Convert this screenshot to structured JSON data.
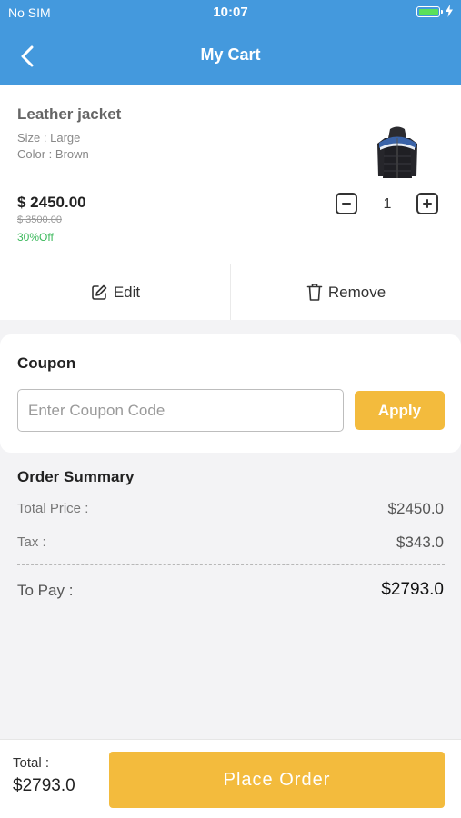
{
  "status_bar": {
    "carrier": "No SIM",
    "time": "10:07",
    "battery_level": 1.0,
    "charging": true,
    "battery_color": "#5be05b"
  },
  "header": {
    "title": "My Cart",
    "back_icon": "chevron-left-icon",
    "background_color": "#4499dd"
  },
  "cart_item": {
    "name": "Leather jacket",
    "size": "Size : Large",
    "color": "Color : Brown",
    "image_icon": "jacket-image",
    "price": "$ 2450.00",
    "old_price": "$ 3500.00",
    "discount": "30%Off",
    "discount_color": "#3cb95c",
    "quantity": "1",
    "minus_icon": "minus-icon",
    "plus_icon": "plus-icon"
  },
  "actions": {
    "edit_label": "Edit",
    "edit_icon": "edit-icon",
    "remove_label": "Remove",
    "remove_icon": "trash-icon"
  },
  "coupon": {
    "title": "Coupon",
    "placeholder": "Enter Coupon Code",
    "value": "",
    "apply_label": "Apply"
  },
  "summary": {
    "title": "Order Summary",
    "total_price_label": "Total Price :",
    "total_price_value": "$2450.0",
    "tax_label": "Tax :",
    "tax_value": "$343.0",
    "to_pay_label": "To Pay :",
    "to_pay_value": "$2793.0"
  },
  "bottom_bar": {
    "total_label": "Total :",
    "total_value": "$2793.0",
    "place_order_label": "Place Order"
  },
  "colors": {
    "accent": "#f3bb3d",
    "background": "#f3f3f5"
  }
}
